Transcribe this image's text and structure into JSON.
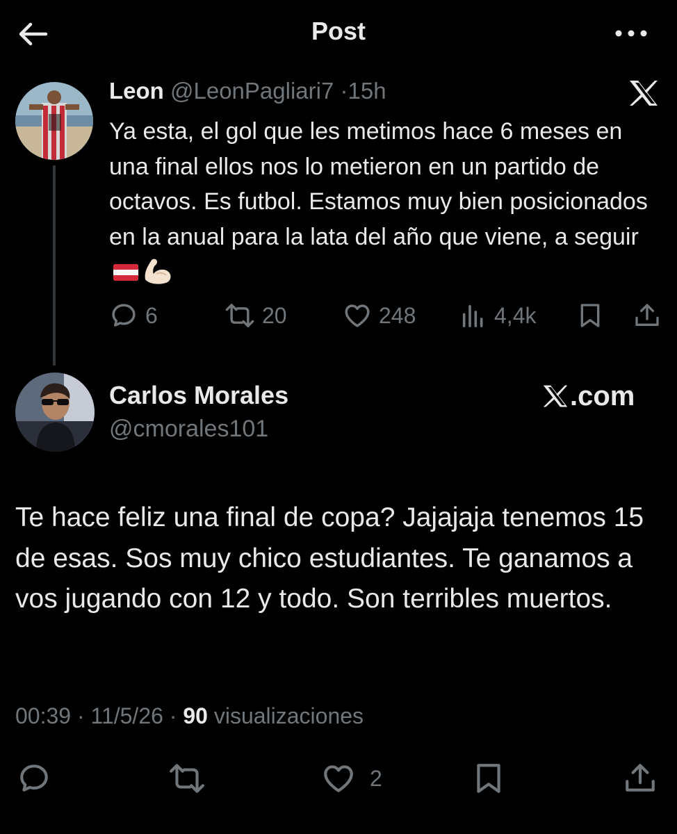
{
  "header": {
    "title": "Post"
  },
  "reply_tweet": {
    "name": "Leon",
    "handle": "@LeonPagliari7",
    "separator": "·",
    "time": "15h",
    "text": "Ya esta, el gol que les metimos hace 6 meses en una final ellos nos lo metieron en un partido de octavos. Es futbol. Estamos muy bien posicionados en la anual para la lata del año que viene, a seguir",
    "emojis": [
      "flag-emoji",
      "flexed-biceps-emoji"
    ],
    "stats": {
      "replies": "6",
      "reposts": "20",
      "likes": "248",
      "views": "4,4k"
    }
  },
  "main_post": {
    "name": "Carlos Morales",
    "handle": "@cmorales101",
    "brand": ".com",
    "text": "Te hace feliz una final de copa? Jajajaja tenemos 15 de esas. Sos muy chico estudiantes. Te ganamos a vos jugando con 12 y todo. Son terribles muertos.",
    "time": "00:39",
    "date": "11/5/26",
    "sep1": "·",
    "sep2": "·",
    "views_count": "90",
    "views_label": "visualizaciones",
    "stats": {
      "likes": "2"
    }
  },
  "colors": {
    "background": "#000000",
    "text": "#e7e9ea",
    "muted": "#71767b",
    "thread_line": "#333639"
  },
  "icons": [
    "back-arrow-icon",
    "more-icon",
    "x-logo-icon",
    "reply-icon",
    "repost-icon",
    "like-icon",
    "views-icon",
    "bookmark-icon",
    "share-icon"
  ]
}
